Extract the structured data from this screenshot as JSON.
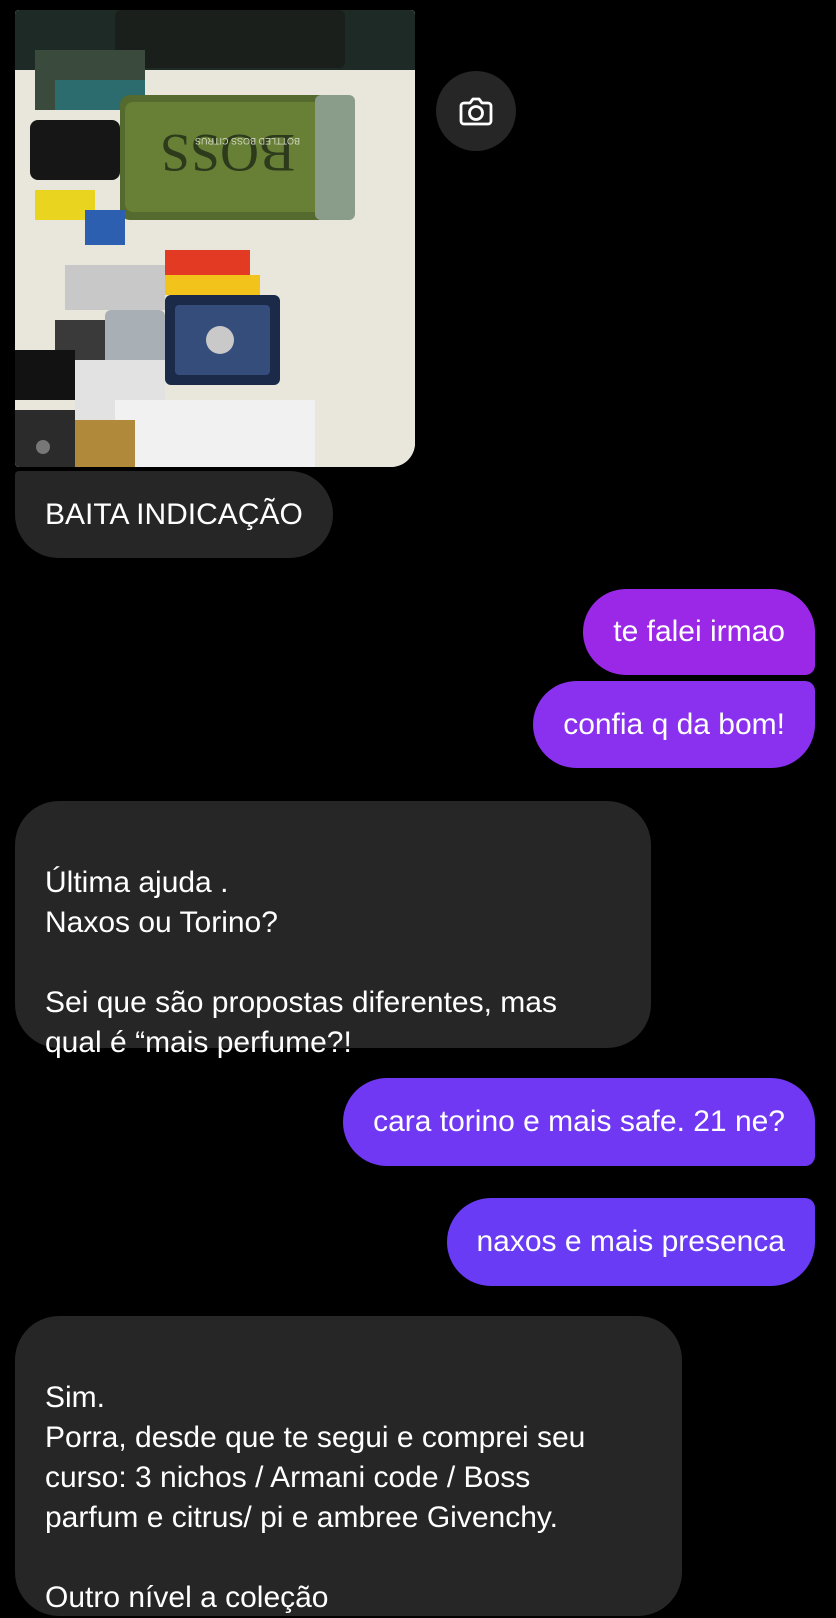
{
  "colors": {
    "background": "#000000",
    "received_bubble": "#262626",
    "sent_bubble_top": "#9a28e6",
    "sent_bubble_bottom": "#6a3bf5"
  },
  "shared_photo": {
    "description_icon": "camera-icon",
    "visible_text": [
      "BOSS",
      "BOTTLED BOSS CITRUS"
    ]
  },
  "messages": [
    {
      "from": "them",
      "text": "BAITA INDICAÇÃO"
    },
    {
      "from": "me",
      "text": "te falei irmao"
    },
    {
      "from": "me",
      "text": "confia q da bom!"
    },
    {
      "from": "them",
      "text": "Última ajuda .\nNaxos ou Torino?\n\nSei que são propostas diferentes, mas\nqual é “mais perfume?!"
    },
    {
      "from": "me",
      "text": "cara torino e mais safe. 21 ne?"
    },
    {
      "from": "me",
      "text": "naxos e mais presenca"
    },
    {
      "from": "them",
      "text": "Sim.\nPorra, desde que te segui e comprei seu\ncurso: 3 nichos / Armani code / Boss\nparfum e citrus/ pi e ambree Givenchy.\n\nOutro nível a coleção"
    }
  ]
}
